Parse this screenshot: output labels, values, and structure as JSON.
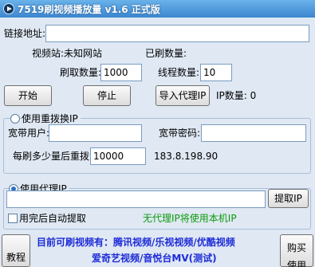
{
  "app": {
    "title": "7519刷视频播放量 v1.6  正式版",
    "accent_color": "#3c86cf",
    "icon": "play-circle-icon"
  },
  "link": {
    "label": "链接地址:",
    "value": ""
  },
  "info": {
    "site_label": "视频站:未知网站",
    "brushed_label": "已刷数量:"
  },
  "settings": {
    "brush_count_label": "刷取数量:",
    "brush_count_value": "1000",
    "thread_count_label": "线程数量:",
    "thread_count_value": "10"
  },
  "actions": {
    "start": "开始",
    "stop": "停止",
    "import_proxy": "导入代理IP",
    "ip_count_label": "IP数量: 0"
  },
  "redial": {
    "option_label": "使用重拨换IP",
    "selected": false,
    "user_label": "宽带用户:",
    "user_value": "",
    "password_label": "宽带密码:",
    "password_value": "",
    "interval_label": "每刷多少量后重拨:",
    "interval_value": "10000",
    "current_ip": "183.8.198.90"
  },
  "proxy": {
    "option_label": "使用代理IP",
    "selected": true,
    "api_value": "",
    "fetch_button": "提取IP",
    "auto_fetch_label": "用完后自动提取",
    "auto_fetch_checked": false,
    "notice": "无代理IP将使用本机IP",
    "notice_color": "#0b9b0b"
  },
  "footer": {
    "tutorial_button": "教程",
    "supported_line1": "目前可刷视频有：腾讯视频/乐视视频/优酷视频",
    "supported_line2": "爱奇艺视频/音悦台MV(测试)",
    "buy_button_line1": "购买",
    "buy_button_line2": "使用"
  }
}
